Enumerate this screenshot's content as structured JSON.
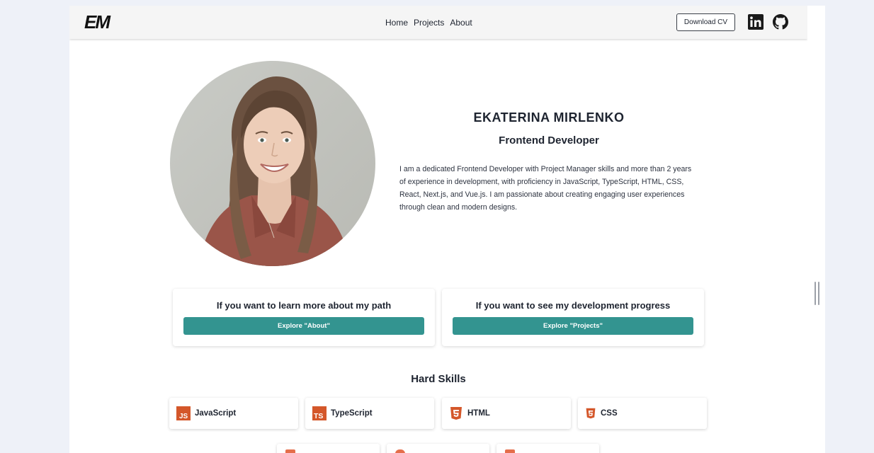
{
  "header": {
    "logo_text": "EM",
    "nav": [
      {
        "label": "Home"
      },
      {
        "label": "Projects"
      },
      {
        "label": "About"
      }
    ],
    "download_cv_label": "Download CV",
    "social": [
      "linkedin-icon",
      "github-icon"
    ]
  },
  "hero": {
    "name": "EKATERINA MIRLENKO",
    "role": "Frontend Developer",
    "bio": "I am a dedicated Frontend Developer with Project Manager skills and more than 2 years of experience in development, with proficiency in JavaScript, TypeScript, HTML, CSS, React, Next.js, and Vue.js. I am passionate about creating engaging user experiences through clean and modern designs."
  },
  "cta": [
    {
      "title": "If you want to learn more about my path",
      "button": "Explore \"About\""
    },
    {
      "title": "If you want to see my development progress",
      "button": "Explore \"Projects\""
    }
  ],
  "skills": {
    "title": "Hard Skills",
    "items": [
      {
        "label": "JavaScript",
        "icon": "javascript-icon"
      },
      {
        "label": "TypeScript",
        "icon": "typescript-icon"
      },
      {
        "label": "HTML",
        "icon": "html5-icon"
      },
      {
        "label": "CSS",
        "icon": "css3-icon"
      }
    ]
  },
  "colors": {
    "accent": "#339490",
    "icon_orange": "#d4572a",
    "page_bg": "#eef1f8"
  }
}
